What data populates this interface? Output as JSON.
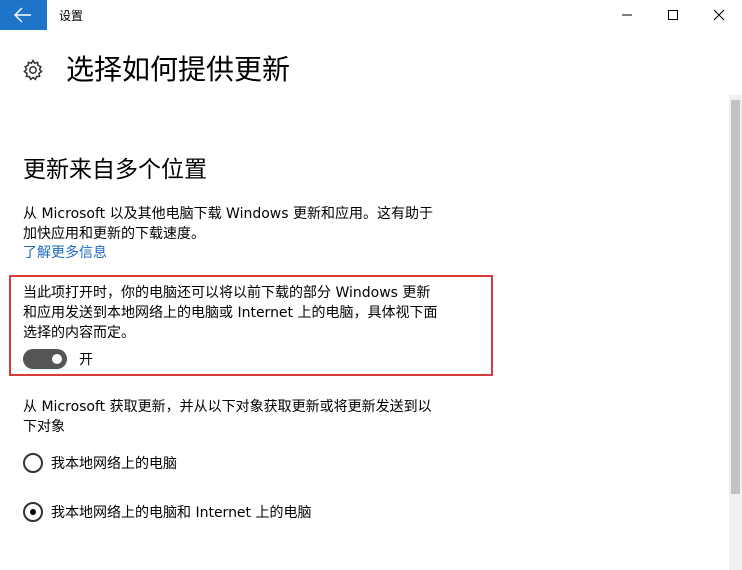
{
  "window": {
    "app_title": "设置",
    "back_icon": "arrow-left-icon",
    "minimize_icon": "minimize-icon",
    "maximize_icon": "maximize-icon",
    "close_icon": "close-icon",
    "accent_color": "#1e74c8"
  },
  "page": {
    "title": "选择如何提供更新",
    "title_icon": "gear-icon"
  },
  "section": {
    "title": "更新来自多个位置",
    "description_lines": [
      "从 Microsoft 以及其他电脑下载 Windows 更新和应用。这有助于",
      "加快应用和更新的下载速度。"
    ],
    "learn_more": "了解更多信息",
    "link_color": "#1e6ac2"
  },
  "toggle": {
    "description_lines": [
      "当此项打开时，你的电脑还可以将以前下载的部分 Windows 更新",
      "和应用发送到本地网络上的电脑或 Internet 上的电脑，具体视下面",
      "选择的内容而定。"
    ],
    "state_label": "开",
    "is_on": true,
    "highlight_color": "#d93a3c"
  },
  "source": {
    "description_lines": [
      "从 Microsoft 获取更新，并从以下对象获取更新或将更新发送到以",
      "下对象"
    ],
    "options": [
      {
        "label": "我本地网络上的电脑",
        "selected": false
      },
      {
        "label": "我本地网络上的电脑和 Internet 上的电脑",
        "selected": true
      }
    ]
  }
}
